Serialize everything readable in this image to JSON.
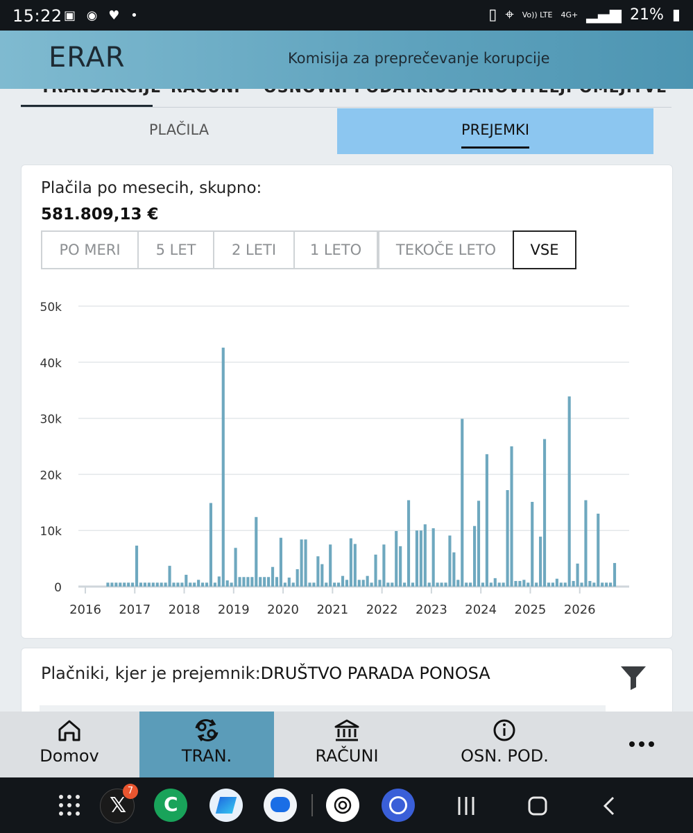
{
  "status_bar": {
    "time": "15:22",
    "net_top": "Vo)) LTE",
    "net_gen": "4G+",
    "battery": "21%",
    "icons": [
      "samsung-pay-icon",
      "nfc-icon",
      "heart-icon",
      "dot-icon"
    ]
  },
  "app": {
    "logo": "ERAR",
    "org": "Komisija za preprečevanje korupcije"
  },
  "main_tabs": [
    "TRANSAKCIJE",
    "RAČUNI",
    "OSNOVNI PODATKI",
    "USTANOVITELJI",
    "OMEJITVE"
  ],
  "sub_tabs": {
    "left": "PLAČILA",
    "right": "PREJEMKI"
  },
  "card": {
    "title": "Plačila po mesecih, skupno:",
    "total": "581.809,13 €",
    "ranges": [
      "PO MERI",
      "5 LET",
      "2 LETI",
      "1 LETO",
      "TEKOČE LETO",
      "VSE"
    ],
    "selected_range": "VSE"
  },
  "chart_data": {
    "type": "bar",
    "title": "",
    "xlabel": "",
    "ylabel": "",
    "ylim": [
      0,
      50000
    ],
    "ytick_labels": [
      "0",
      "10k",
      "20k",
      "30k",
      "40k",
      "50k"
    ],
    "xtick_labels": [
      "2016",
      "2017",
      "2018",
      "2019",
      "2020",
      "2021",
      "2022",
      "2023",
      "2024",
      "2025",
      "2026"
    ],
    "x_start": "2016-01",
    "bar_color": "#6ea8bf",
    "grid": true,
    "values": [
      0,
      0,
      0,
      0,
      0,
      700,
      700,
      700,
      700,
      700,
      700,
      700,
      7300,
      700,
      700,
      700,
      700,
      700,
      700,
      700,
      3700,
      700,
      700,
      700,
      2100,
      700,
      700,
      1200,
      700,
      700,
      14900,
      700,
      1800,
      42600,
      1100,
      700,
      6900,
      1700,
      1700,
      1700,
      1700,
      12400,
      1700,
      1700,
      1700,
      3500,
      1700,
      8700,
      700,
      1600,
      700,
      3100,
      8400,
      8400,
      700,
      700,
      5400,
      4000,
      700,
      7500,
      700,
      700,
      1900,
      1200,
      8600,
      7600,
      1200,
      1200,
      1900,
      700,
      5700,
      1200,
      7500,
      700,
      700,
      9900,
      7200,
      700,
      15400,
      700,
      10000,
      10000,
      11100,
      700,
      10400,
      700,
      700,
      700,
      9100,
      6100,
      1200,
      29900,
      700,
      700,
      10800,
      15300,
      700,
      23600,
      700,
      1500,
      700,
      700,
      17200,
      25000,
      1000,
      1000,
      1200,
      700,
      15100,
      700,
      8900,
      26300,
      700,
      700,
      1400,
      700,
      700,
      33900,
      1000,
      4100,
      700,
      15400,
      1000,
      700,
      13000,
      700,
      700,
      700,
      4200,
      0,
      0,
      0
    ]
  },
  "payers": {
    "label": "Plačniki, kjer je prejemnik:",
    "recipient": "DRUŠTVO PARADA PONOSA"
  },
  "bottom_nav": [
    "Domov",
    "TRAN.",
    "RAČUNI",
    "OSN. POD."
  ],
  "badge_x": "7"
}
